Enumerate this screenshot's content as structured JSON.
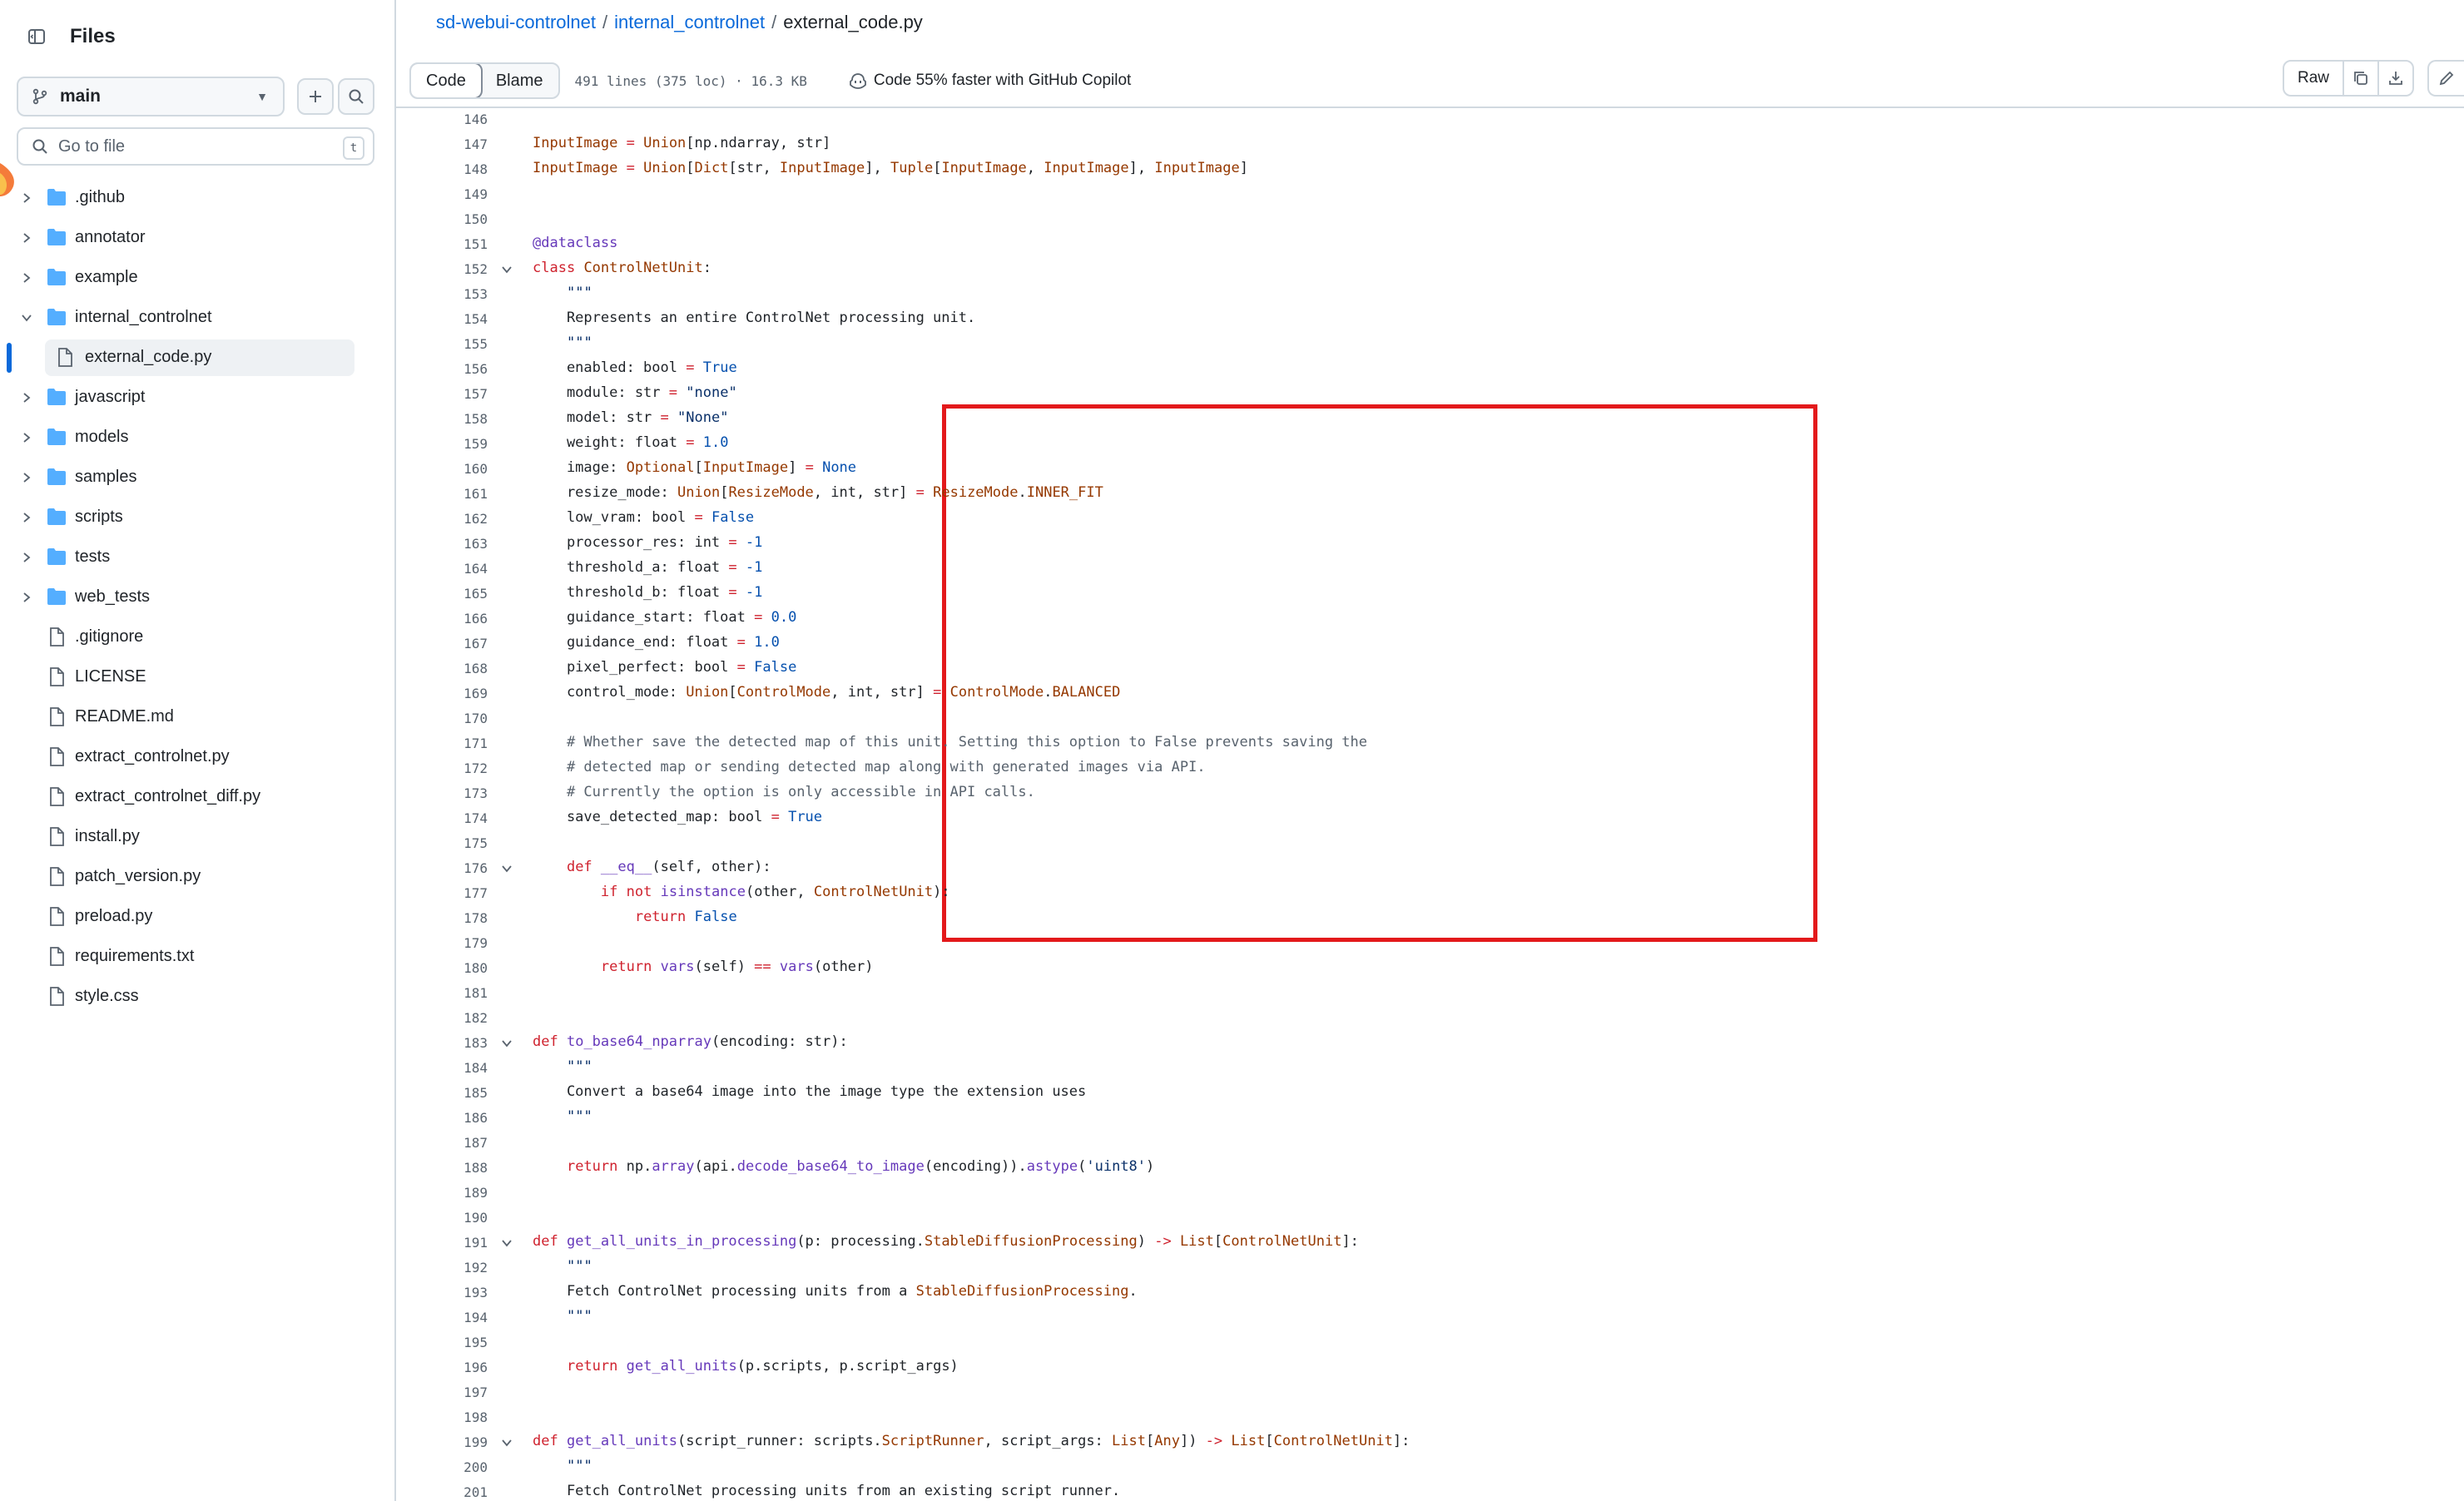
{
  "sidebar": {
    "title": "Files",
    "branch": "main",
    "goto_placeholder": "Go to file",
    "goto_shortcut": "t",
    "items": [
      {
        "label": ".github",
        "type": "folder",
        "expanded": false
      },
      {
        "label": "annotator",
        "type": "folder",
        "expanded": false
      },
      {
        "label": "example",
        "type": "folder",
        "expanded": false
      },
      {
        "label": "internal_controlnet",
        "type": "folder",
        "expanded": true
      },
      {
        "label": "external_code.py",
        "type": "file",
        "selected": true
      },
      {
        "label": "javascript",
        "type": "folder",
        "expanded": false
      },
      {
        "label": "models",
        "type": "folder",
        "expanded": false
      },
      {
        "label": "samples",
        "type": "folder",
        "expanded": false
      },
      {
        "label": "scripts",
        "type": "folder",
        "expanded": false
      },
      {
        "label": "tests",
        "type": "folder",
        "expanded": false
      },
      {
        "label": "web_tests",
        "type": "folder",
        "expanded": false
      },
      {
        "label": ".gitignore",
        "type": "file"
      },
      {
        "label": "LICENSE",
        "type": "file"
      },
      {
        "label": "README.md",
        "type": "file"
      },
      {
        "label": "extract_controlnet.py",
        "type": "file"
      },
      {
        "label": "extract_controlnet_diff.py",
        "type": "file"
      },
      {
        "label": "install.py",
        "type": "file"
      },
      {
        "label": "patch_version.py",
        "type": "file"
      },
      {
        "label": "preload.py",
        "type": "file"
      },
      {
        "label": "requirements.txt",
        "type": "file"
      },
      {
        "label": "style.css",
        "type": "file"
      }
    ]
  },
  "breadcrumb": {
    "repo": "sd-webui-controlnet",
    "folder": "internal_controlnet",
    "file": "external_code.py",
    "separator": "/"
  },
  "toolbar": {
    "code_tab": "Code",
    "blame_tab": "Blame",
    "file_meta": "491 lines (375 loc) · 16.3 KB",
    "copilot_note": "Code 55% faster with GitHub Copilot",
    "raw_label": "Raw"
  },
  "colors": {
    "accent": "#0969da",
    "highlight_box": "#e3191b",
    "keyword": "#cf222e",
    "function": "#6639ba",
    "type": "#953800",
    "constant": "#0550ae"
  },
  "code": {
    "lines": [
      {
        "n": "146",
        "text": ""
      },
      {
        "n": "147",
        "text": "InputImage = Union[np.ndarray, str]"
      },
      {
        "n": "148",
        "text": "InputImage = Union[Dict[str, InputImage], Tuple[InputImage, InputImage], InputImage]"
      },
      {
        "n": "149",
        "text": ""
      },
      {
        "n": "150",
        "text": ""
      },
      {
        "n": "151",
        "text": "@dataclass"
      },
      {
        "n": "152",
        "text": "class ControlNetUnit:",
        "fold": true
      },
      {
        "n": "153",
        "text": "    \"\"\""
      },
      {
        "n": "154",
        "text": "    Represents an entire ControlNet processing unit."
      },
      {
        "n": "155",
        "text": "    \"\"\""
      },
      {
        "n": "156",
        "text": "    enabled: bool = True"
      },
      {
        "n": "157",
        "text": "    module: str = \"none\""
      },
      {
        "n": "158",
        "text": "    model: str = \"None\""
      },
      {
        "n": "159",
        "text": "    weight: float = 1.0"
      },
      {
        "n": "160",
        "text": "    image: Optional[InputImage] = None"
      },
      {
        "n": "161",
        "text": "    resize_mode: Union[ResizeMode, int, str] = ResizeMode.INNER_FIT"
      },
      {
        "n": "162",
        "text": "    low_vram: bool = False"
      },
      {
        "n": "163",
        "text": "    processor_res: int = -1"
      },
      {
        "n": "164",
        "text": "    threshold_a: float = -1"
      },
      {
        "n": "165",
        "text": "    threshold_b: float = -1"
      },
      {
        "n": "166",
        "text": "    guidance_start: float = 0.0"
      },
      {
        "n": "167",
        "text": "    guidance_end: float = 1.0"
      },
      {
        "n": "168",
        "text": "    pixel_perfect: bool = False"
      },
      {
        "n": "169",
        "text": "    control_mode: Union[ControlMode, int, str] = ControlMode.BALANCED"
      },
      {
        "n": "170",
        "text": ""
      },
      {
        "n": "171",
        "text": "    # Whether save the detected map of this unit. Setting this option to False prevents saving the"
      },
      {
        "n": "172",
        "text": "    # detected map or sending detected map along with generated images via API."
      },
      {
        "n": "173",
        "text": "    # Currently the option is only accessible in API calls."
      },
      {
        "n": "174",
        "text": "    save_detected_map: bool = True"
      },
      {
        "n": "175",
        "text": ""
      },
      {
        "n": "176",
        "text": "    def __eq__(self, other):",
        "fold": true
      },
      {
        "n": "177",
        "text": "        if not isinstance(other, ControlNetUnit):"
      },
      {
        "n": "178",
        "text": "            return False"
      },
      {
        "n": "179",
        "text": ""
      },
      {
        "n": "180",
        "text": "        return vars(self) == vars(other)"
      },
      {
        "n": "181",
        "text": ""
      },
      {
        "n": "182",
        "text": ""
      },
      {
        "n": "183",
        "text": "def to_base64_nparray(encoding: str):",
        "fold": true
      },
      {
        "n": "184",
        "text": "    \"\"\""
      },
      {
        "n": "185",
        "text": "    Convert a base64 image into the image type the extension uses"
      },
      {
        "n": "186",
        "text": "    \"\"\""
      },
      {
        "n": "187",
        "text": ""
      },
      {
        "n": "188",
        "text": "    return np.array(api.decode_base64_to_image(encoding)).astype('uint8')"
      },
      {
        "n": "189",
        "text": ""
      },
      {
        "n": "190",
        "text": ""
      },
      {
        "n": "191",
        "text": "def get_all_units_in_processing(p: processing.StableDiffusionProcessing) -> List[ControlNetUnit]:",
        "fold": true
      },
      {
        "n": "192",
        "text": "    \"\"\""
      },
      {
        "n": "193",
        "text": "    Fetch ControlNet processing units from a StableDiffusionProcessing."
      },
      {
        "n": "194",
        "text": "    \"\"\""
      },
      {
        "n": "195",
        "text": ""
      },
      {
        "n": "196",
        "text": "    return get_all_units(p.scripts, p.script_args)"
      },
      {
        "n": "197",
        "text": ""
      },
      {
        "n": "198",
        "text": ""
      },
      {
        "n": "199",
        "text": "def get_all_units(script_runner: scripts.ScriptRunner, script_args: List[Any]) -> List[ControlNetUnit]:",
        "fold": true
      },
      {
        "n": "200",
        "text": "    \"\"\""
      },
      {
        "n": "201",
        "text": "    Fetch ControlNet processing units from an existing script runner."
      }
    ]
  }
}
